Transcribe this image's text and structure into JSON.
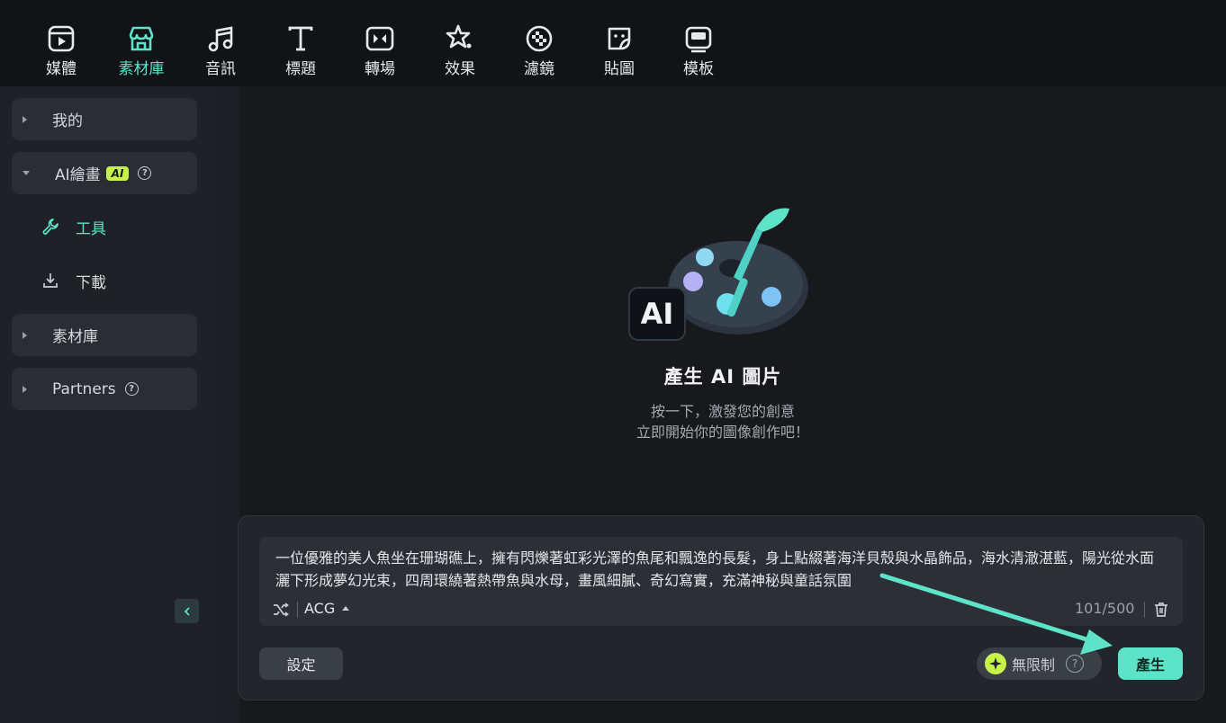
{
  "toolbar": {
    "items": [
      {
        "label": "媒體",
        "icon": "media-icon"
      },
      {
        "label": "素材庫",
        "icon": "store-icon"
      },
      {
        "label": "音訊",
        "icon": "music-icon"
      },
      {
        "label": "標題",
        "icon": "title-icon"
      },
      {
        "label": "轉場",
        "icon": "transition-icon"
      },
      {
        "label": "效果",
        "icon": "effects-icon"
      },
      {
        "label": "濾鏡",
        "icon": "filter-icon"
      },
      {
        "label": "貼圖",
        "icon": "sticker-icon"
      },
      {
        "label": "模板",
        "icon": "template-icon"
      }
    ],
    "active_label": "素材庫"
  },
  "sidebar": {
    "my": "我的",
    "ai_paint": "AI繪畫",
    "ai_badge": "AI",
    "tools": "工具",
    "download": "下載",
    "library": "素材庫",
    "partners": "Partners",
    "help_glyph": "?"
  },
  "hero": {
    "badge": "AI",
    "title": "產生 AI 圖片",
    "subtitle_line1": "按一下，激發您的創意",
    "subtitle_line2": "立即開始你的圖像創作吧！"
  },
  "prompt": {
    "text": "一位優雅的美人魚坐在珊瑚礁上，擁有閃爍著虹彩光澤的魚尾和飄逸的長髮，身上點綴著海洋貝殼與水晶飾品，海水清澈湛藍，陽光從水面灑下形成夢幻光束，四周環繞著熱帶魚與水母，畫風細膩、奇幻寫實，充滿神秘與童話氛圍",
    "style": "ACG",
    "counter": "101/500"
  },
  "actions": {
    "settings": "設定",
    "unlimited": "無限制",
    "help_glyph": "?",
    "generate": "產生"
  },
  "colors": {
    "accent": "#5ce3c8",
    "badge": "#c6f24a"
  }
}
